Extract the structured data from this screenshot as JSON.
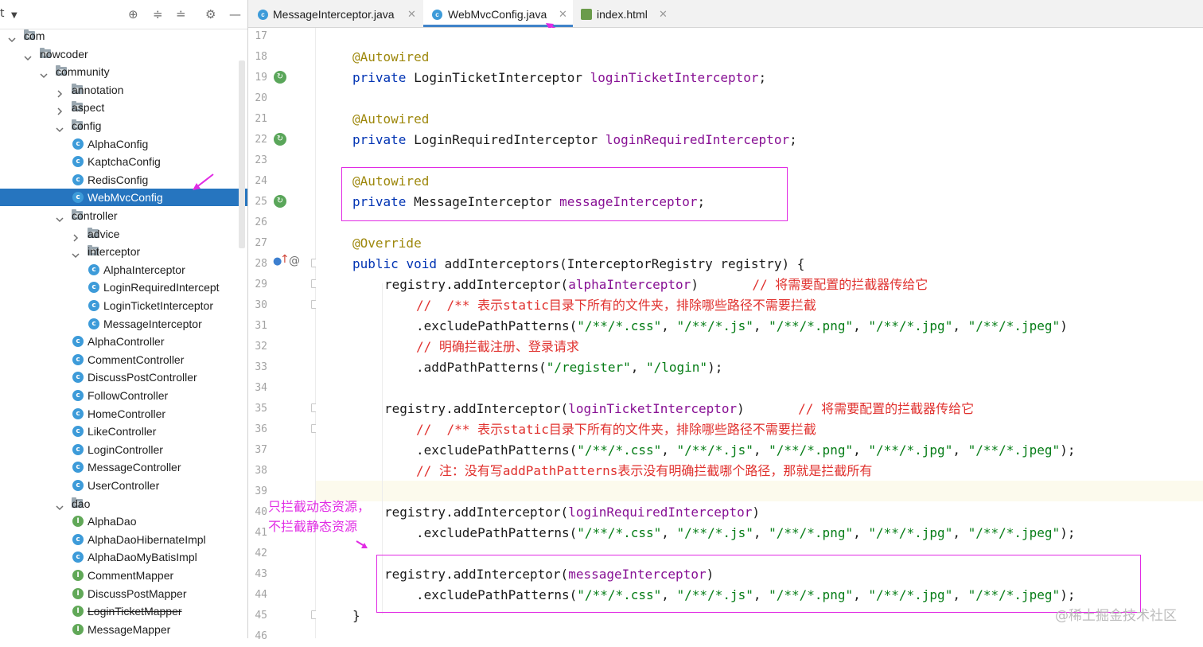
{
  "tree": {
    "toolbar_icons": [
      "locate-icon",
      "expand-all-icon",
      "collapse-all-icon",
      "gear-icon",
      "minimize-icon"
    ],
    "items": [
      {
        "label": "com",
        "kind": "package",
        "expanded": true
      },
      {
        "label": "nowcoder",
        "kind": "package",
        "expanded": true
      },
      {
        "label": "community",
        "kind": "package",
        "expanded": true
      },
      {
        "label": "annotation",
        "kind": "package",
        "expanded": false
      },
      {
        "label": "aspect",
        "kind": "package",
        "expanded": false
      },
      {
        "label": "config",
        "kind": "package",
        "expanded": true
      },
      {
        "label": "AlphaConfig",
        "kind": "class"
      },
      {
        "label": "KaptchaConfig",
        "kind": "class"
      },
      {
        "label": "RedisConfig",
        "kind": "class"
      },
      {
        "label": "WebMvcConfig",
        "kind": "class",
        "selected": true
      },
      {
        "label": "controller",
        "kind": "package",
        "expanded": true
      },
      {
        "label": "advice",
        "kind": "package",
        "expanded": false
      },
      {
        "label": "interceptor",
        "kind": "package",
        "expanded": true
      },
      {
        "label": "AlphaInterceptor",
        "kind": "class"
      },
      {
        "label": "LoginRequiredIntercept",
        "kind": "class"
      },
      {
        "label": "LoginTicketInterceptor",
        "kind": "class"
      },
      {
        "label": "MessageInterceptor",
        "kind": "class"
      },
      {
        "label": "AlphaController",
        "kind": "class"
      },
      {
        "label": "CommentController",
        "kind": "class"
      },
      {
        "label": "DiscussPostController",
        "kind": "class"
      },
      {
        "label": "FollowController",
        "kind": "class"
      },
      {
        "label": "HomeController",
        "kind": "class"
      },
      {
        "label": "LikeController",
        "kind": "class"
      },
      {
        "label": "LoginController",
        "kind": "class"
      },
      {
        "label": "MessageController",
        "kind": "class"
      },
      {
        "label": "UserController",
        "kind": "class"
      },
      {
        "label": "dao",
        "kind": "package",
        "expanded": true
      },
      {
        "label": "AlphaDao",
        "kind": "interface"
      },
      {
        "label": "AlphaDaoHibernateImpl",
        "kind": "class"
      },
      {
        "label": "AlphaDaoMyBatisImpl",
        "kind": "class"
      },
      {
        "label": "CommentMapper",
        "kind": "interface"
      },
      {
        "label": "DiscussPostMapper",
        "kind": "interface"
      },
      {
        "label": "LoginTicketMapper",
        "kind": "interface",
        "deprecated": true
      },
      {
        "label": "MessageMapper",
        "kind": "interface"
      }
    ]
  },
  "tabs": [
    {
      "label": "MessageInterceptor.java",
      "icon": "java-class-icon",
      "active": false
    },
    {
      "label": "WebMvcConfig.java",
      "icon": "java-class-icon",
      "active": true
    },
    {
      "label": "index.html",
      "icon": "html-file-icon",
      "active": false
    }
  ],
  "editor": {
    "lines": [
      {
        "n": "17",
        "indent": 0,
        "tokens": []
      },
      {
        "n": "18",
        "indent": 0,
        "tokens": [
          {
            "t": "@Autowired",
            "c": "ann"
          }
        ]
      },
      {
        "n": "19",
        "indent": 0,
        "tokens": [
          {
            "t": "private",
            "c": "kw"
          },
          {
            "t": " LoginTicketInterceptor ",
            "c": ""
          },
          {
            "t": "loginTicketInterceptor",
            "c": "fld"
          },
          {
            "t": ";",
            "c": ""
          }
        ]
      },
      {
        "n": "20",
        "indent": 0,
        "tokens": []
      },
      {
        "n": "21",
        "indent": 0,
        "tokens": [
          {
            "t": "@Autowired",
            "c": "ann"
          }
        ]
      },
      {
        "n": "22",
        "indent": 0,
        "tokens": [
          {
            "t": "private",
            "c": "kw"
          },
          {
            "t": " LoginRequiredInterceptor ",
            "c": ""
          },
          {
            "t": "loginRequiredInterceptor",
            "c": "fld"
          },
          {
            "t": ";",
            "c": ""
          }
        ]
      },
      {
        "n": "23",
        "indent": 0,
        "tokens": []
      },
      {
        "n": "24",
        "indent": 0,
        "tokens": [
          {
            "t": "@Autowired",
            "c": "ann"
          }
        ]
      },
      {
        "n": "25",
        "indent": 0,
        "tokens": [
          {
            "t": "private",
            "c": "kw"
          },
          {
            "t": " MessageInterceptor ",
            "c": ""
          },
          {
            "t": "messageInterceptor",
            "c": "fld"
          },
          {
            "t": ";",
            "c": ""
          }
        ]
      },
      {
        "n": "26",
        "indent": 0,
        "tokens": []
      },
      {
        "n": "27",
        "indent": 0,
        "tokens": [
          {
            "t": "@Override",
            "c": "ann"
          }
        ]
      },
      {
        "n": "28",
        "indent": 0,
        "tokens": [
          {
            "t": "public",
            "c": "kw"
          },
          {
            "t": " ",
            "c": ""
          },
          {
            "t": "void",
            "c": "kw"
          },
          {
            "t": " addInterceptors(InterceptorRegistry registry) {",
            "c": ""
          }
        ]
      },
      {
        "n": "29",
        "indent": 1,
        "tokens": [
          {
            "t": "registry.addInterceptor(",
            "c": ""
          },
          {
            "t": "alphaInterceptor",
            "c": "fld"
          },
          {
            "t": ")       ",
            "c": ""
          },
          {
            "t": "// 将需要配置的拦截器传给它",
            "c": "cmt"
          }
        ]
      },
      {
        "n": "30",
        "indent": 2,
        "tokens": [
          {
            "t": "//  /** 表示static目录下所有的文件夹，排除哪些路径不需要拦截",
            "c": "cmt"
          }
        ]
      },
      {
        "n": "31",
        "indent": 2,
        "tokens": [
          {
            "t": ".excludePathPatterns(",
            "c": ""
          },
          {
            "t": "\"/**/*.css\"",
            "c": "str"
          },
          {
            "t": ", ",
            "c": ""
          },
          {
            "t": "\"/**/*.js\"",
            "c": "str"
          },
          {
            "t": ", ",
            "c": ""
          },
          {
            "t": "\"/**/*.png\"",
            "c": "str"
          },
          {
            "t": ", ",
            "c": ""
          },
          {
            "t": "\"/**/*.jpg\"",
            "c": "str"
          },
          {
            "t": ", ",
            "c": ""
          },
          {
            "t": "\"/**/*.jpeg\"",
            "c": "str"
          },
          {
            "t": ")",
            "c": ""
          }
        ]
      },
      {
        "n": "32",
        "indent": 2,
        "tokens": [
          {
            "t": "// 明确拦截注册、登录请求",
            "c": "cmt"
          }
        ]
      },
      {
        "n": "33",
        "indent": 2,
        "tokens": [
          {
            "t": ".addPathPatterns(",
            "c": ""
          },
          {
            "t": "\"/register\"",
            "c": "str"
          },
          {
            "t": ", ",
            "c": ""
          },
          {
            "t": "\"/login\"",
            "c": "str"
          },
          {
            "t": ");",
            "c": ""
          }
        ]
      },
      {
        "n": "34",
        "indent": 0,
        "tokens": []
      },
      {
        "n": "35",
        "indent": 1,
        "tokens": [
          {
            "t": "registry.addInterceptor(",
            "c": ""
          },
          {
            "t": "loginTicketInterceptor",
            "c": "fld"
          },
          {
            "t": ")       ",
            "c": ""
          },
          {
            "t": "// 将需要配置的拦截器传给它",
            "c": "cmt"
          }
        ]
      },
      {
        "n": "36",
        "indent": 2,
        "tokens": [
          {
            "t": "//  /** 表示static目录下所有的文件夹，排除哪些路径不需要拦截",
            "c": "cmt"
          }
        ]
      },
      {
        "n": "37",
        "indent": 2,
        "tokens": [
          {
            "t": ".excludePathPatterns(",
            "c": ""
          },
          {
            "t": "\"/**/*.css\"",
            "c": "str"
          },
          {
            "t": ", ",
            "c": ""
          },
          {
            "t": "\"/**/*.js\"",
            "c": "str"
          },
          {
            "t": ", ",
            "c": ""
          },
          {
            "t": "\"/**/*.png\"",
            "c": "str"
          },
          {
            "t": ", ",
            "c": ""
          },
          {
            "t": "\"/**/*.jpg\"",
            "c": "str"
          },
          {
            "t": ", ",
            "c": ""
          },
          {
            "t": "\"/**/*.jpeg\"",
            "c": "str"
          },
          {
            "t": ");",
            "c": ""
          }
        ]
      },
      {
        "n": "38",
        "indent": 2,
        "tokens": [
          {
            "t": "// 注：没有写addPathPatterns表示没有明确拦截哪个路径，那就是拦截所有",
            "c": "cmt"
          }
        ]
      },
      {
        "n": "39",
        "indent": 0,
        "tokens": []
      },
      {
        "n": "40",
        "indent": 1,
        "tokens": [
          {
            "t": "registry.addInterceptor(",
            "c": ""
          },
          {
            "t": "loginRequiredInterceptor",
            "c": "fld"
          },
          {
            "t": ")",
            "c": ""
          }
        ]
      },
      {
        "n": "41",
        "indent": 2,
        "tokens": [
          {
            "t": ".excludePathPatterns(",
            "c": ""
          },
          {
            "t": "\"/**/*.css\"",
            "c": "str"
          },
          {
            "t": ", ",
            "c": ""
          },
          {
            "t": "\"/**/*.js\"",
            "c": "str"
          },
          {
            "t": ", ",
            "c": ""
          },
          {
            "t": "\"/**/*.png\"",
            "c": "str"
          },
          {
            "t": ", ",
            "c": ""
          },
          {
            "t": "\"/**/*.jpg\"",
            "c": "str"
          },
          {
            "t": ", ",
            "c": ""
          },
          {
            "t": "\"/**/*.jpeg\"",
            "c": "str"
          },
          {
            "t": ");",
            "c": ""
          }
        ]
      },
      {
        "n": "42",
        "indent": 0,
        "tokens": []
      },
      {
        "n": "43",
        "indent": 1,
        "tokens": [
          {
            "t": "registry.addInterceptor(",
            "c": ""
          },
          {
            "t": "messageInterceptor",
            "c": "fld"
          },
          {
            "t": ")",
            "c": ""
          }
        ]
      },
      {
        "n": "44",
        "indent": 2,
        "tokens": [
          {
            "t": ".excludePathPatterns(",
            "c": ""
          },
          {
            "t": "\"/**/*.css\"",
            "c": "str"
          },
          {
            "t": ", ",
            "c": ""
          },
          {
            "t": "\"/**/*.js\"",
            "c": "str"
          },
          {
            "t": ", ",
            "c": ""
          },
          {
            "t": "\"/**/*.png\"",
            "c": "str"
          },
          {
            "t": ", ",
            "c": ""
          },
          {
            "t": "\"/**/*.jpg\"",
            "c": "str"
          },
          {
            "t": ", ",
            "c": ""
          },
          {
            "t": "\"/**/*.jpeg\"",
            "c": "str"
          },
          {
            "t": ");",
            "c": ""
          }
        ]
      },
      {
        "n": "45",
        "indent": 0,
        "tokens": [
          {
            "t": "}",
            "c": ""
          }
        ]
      },
      {
        "n": "46",
        "indent": 0,
        "tokens": []
      }
    ]
  },
  "annotations": {
    "note_line1": "只拦截动态资源，",
    "note_line2": "不拦截静态资源",
    "color": "#e12be4"
  },
  "watermark": "@稀土掘金技术社区",
  "colors": {
    "selection": "#2675bf",
    "keyword": "#0033b3",
    "field": "#871094",
    "string": "#067d17",
    "comment": "#e0312e",
    "annotation": "#9e880d"
  }
}
